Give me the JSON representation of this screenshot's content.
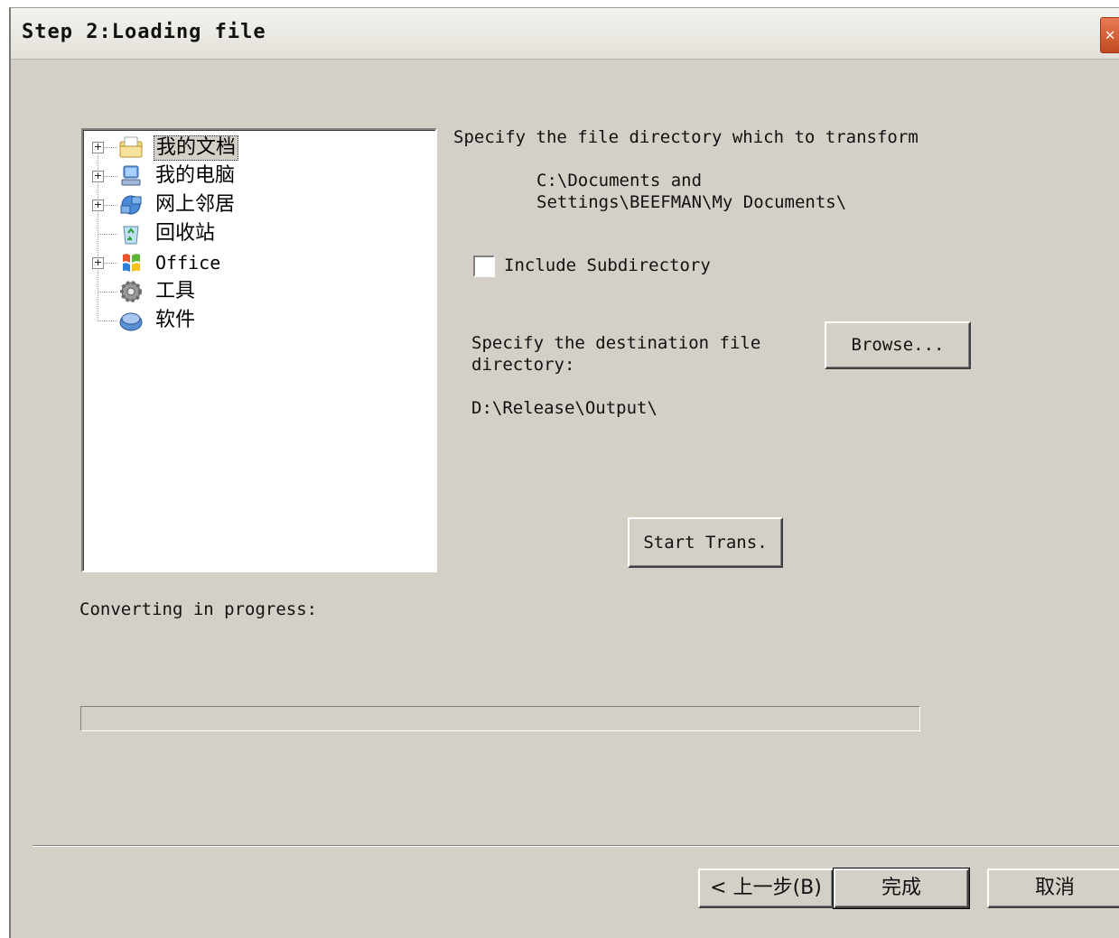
{
  "window": {
    "title": "Step 2:Loading file",
    "close_glyph": "✕"
  },
  "tree": {
    "items": [
      {
        "label": "我的文档",
        "icon": "my-documents-icon",
        "expandable": true,
        "selected": true
      },
      {
        "label": "我的电脑",
        "icon": "my-computer-icon",
        "expandable": true,
        "selected": false
      },
      {
        "label": "网上邻居",
        "icon": "network-places-icon",
        "expandable": true,
        "selected": false
      },
      {
        "label": "回收站",
        "icon": "recycle-bin-icon",
        "expandable": false,
        "selected": false
      },
      {
        "label": "Office",
        "icon": "office-folder-icon",
        "expandable": true,
        "selected": false
      },
      {
        "label": "工具",
        "icon": "tools-gear-icon",
        "expandable": false,
        "selected": false
      },
      {
        "label": "软件",
        "icon": "software-disc-icon",
        "expandable": false,
        "selected": false
      }
    ]
  },
  "source": {
    "prompt": "Specify the file directory which to transform",
    "path_line1": "C:\\Documents and",
    "path_line2": "Settings\\BEEFMAN\\My Documents\\"
  },
  "options": {
    "include_subdirectory_label": "Include Subdirectory",
    "include_subdirectory_checked": false
  },
  "destination": {
    "prompt_line1": "Specify the destination file",
    "prompt_line2": "directory:",
    "path": "D:\\Release\\Output\\",
    "browse_label": "Browse..."
  },
  "actions": {
    "start_label": "Start Trans."
  },
  "progress": {
    "label": "Converting in progress:",
    "value": 0
  },
  "footer": {
    "back_label": "< 上一步(B)",
    "finish_label": "完成",
    "cancel_label": "取消"
  }
}
